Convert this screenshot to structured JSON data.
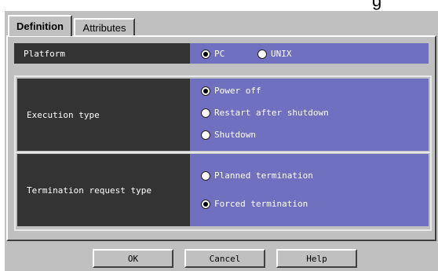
{
  "header_fragment": "g",
  "tabs": [
    {
      "label": "Definition",
      "active": true
    },
    {
      "label": "Attributes",
      "active": false
    }
  ],
  "platform": {
    "label": "Platform",
    "options": [
      {
        "label": "PC",
        "selected": true
      },
      {
        "label": "UNIX",
        "selected": false
      }
    ]
  },
  "execution_type": {
    "label": "Execution type",
    "options": [
      {
        "label": "Power off",
        "selected": true
      },
      {
        "label": "Restart after shutdown",
        "selected": false
      },
      {
        "label": "Shutdown",
        "selected": false
      }
    ]
  },
  "termination_request_type": {
    "label": "Termination request type",
    "options": [
      {
        "label": "Planned termination",
        "selected": false
      },
      {
        "label": "Forced termination",
        "selected": true
      }
    ]
  },
  "buttons": {
    "ok": "OK",
    "cancel": "Cancel",
    "help": "Help"
  },
  "colors": {
    "label_bg": "#333333",
    "value_bg": "#7070c0",
    "dialog_bg": "#c0c0c0"
  }
}
